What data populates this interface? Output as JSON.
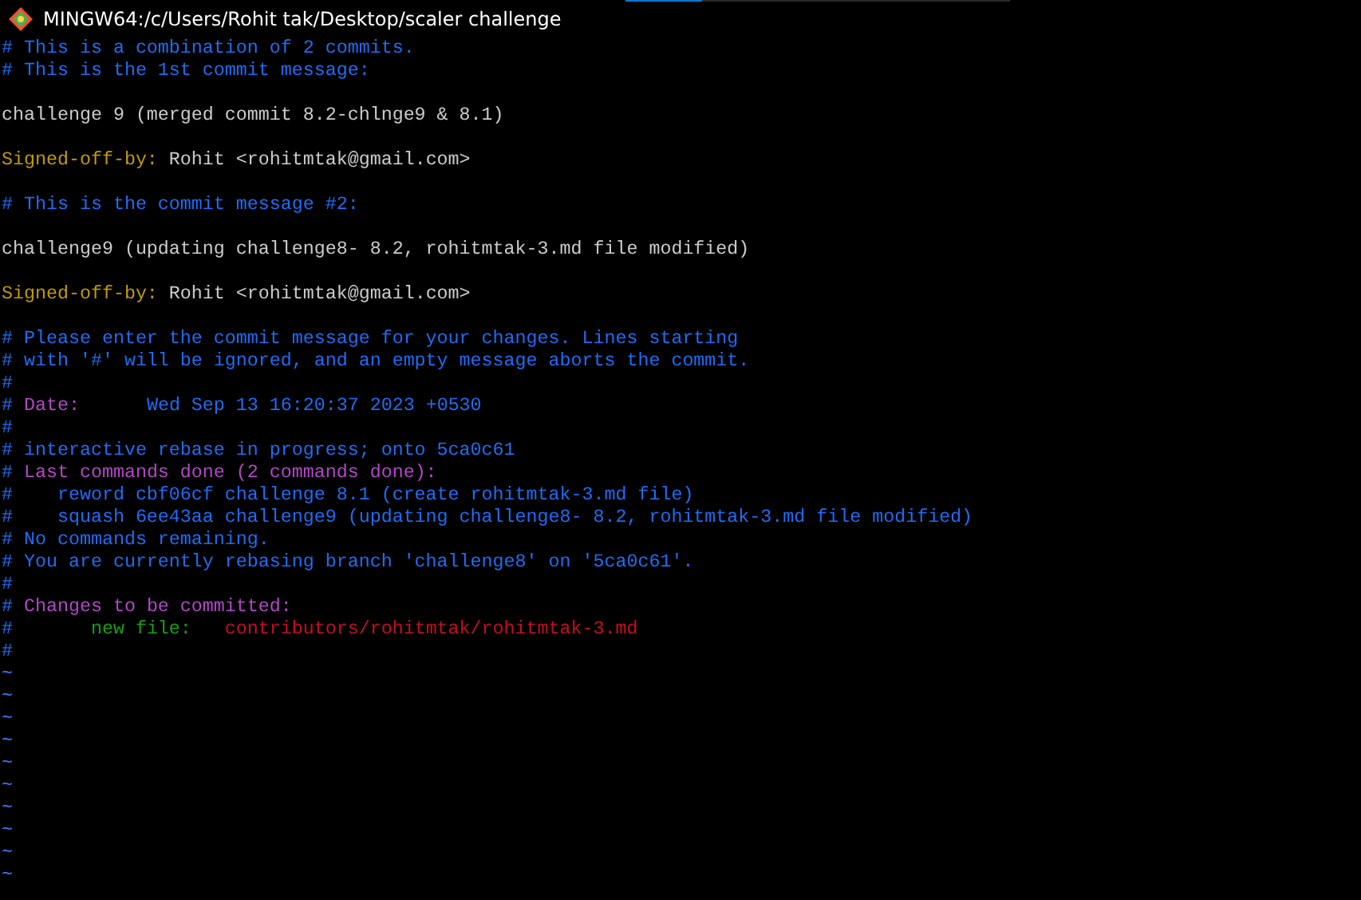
{
  "window": {
    "title": "MINGW64:/c/Users/Rohit tak/Desktop/scaler challenge"
  },
  "progress": {
    "level": 0.2
  },
  "lines": [
    {
      "kind": "text",
      "segments": [
        {
          "kind": "comment",
          "text": "# This is a combination of 2 commits."
        }
      ]
    },
    {
      "kind": "text",
      "segments": [
        {
          "kind": "comment",
          "text": "# This is the 1st commit message:"
        }
      ]
    },
    {
      "kind": "blank"
    },
    {
      "kind": "text",
      "segments": [
        {
          "kind": "plain",
          "text": "challenge 9 (merged commit 8.2-chlnge9 & 8.1)"
        }
      ]
    },
    {
      "kind": "blank"
    },
    {
      "kind": "text",
      "segments": [
        {
          "kind": "label",
          "text": "Signed-off-by:"
        },
        {
          "kind": "plain",
          "text": " Rohit <rohitmtak@gmail.com>"
        }
      ]
    },
    {
      "kind": "blank"
    },
    {
      "kind": "text",
      "segments": [
        {
          "kind": "comment",
          "text": "# This is the commit message #2:"
        }
      ]
    },
    {
      "kind": "blank"
    },
    {
      "kind": "text",
      "segments": [
        {
          "kind": "plain",
          "text": "challenge9 (updating challenge8- 8.2, rohitmtak-3.md file modified)"
        }
      ]
    },
    {
      "kind": "blank"
    },
    {
      "kind": "text",
      "segments": [
        {
          "kind": "label",
          "text": "Signed-off-by:"
        },
        {
          "kind": "plain",
          "text": " Rohit <rohitmtak@gmail.com>"
        }
      ]
    },
    {
      "kind": "blank"
    },
    {
      "kind": "text",
      "segments": [
        {
          "kind": "comment",
          "text": "# Please enter the commit message for your changes. Lines starting"
        }
      ]
    },
    {
      "kind": "text",
      "segments": [
        {
          "kind": "comment",
          "text": "# with '#' will be ignored, and an empty message aborts the commit."
        }
      ]
    },
    {
      "kind": "text",
      "segments": [
        {
          "kind": "comment",
          "text": "#"
        }
      ]
    },
    {
      "kind": "text",
      "segments": [
        {
          "kind": "comment",
          "text": "#"
        },
        {
          "kind": "heading",
          "text": " Date:"
        },
        {
          "kind": "comment",
          "text": "      Wed Sep 13 16:20:37 2023 +0530"
        }
      ]
    },
    {
      "kind": "text",
      "segments": [
        {
          "kind": "comment",
          "text": "#"
        }
      ]
    },
    {
      "kind": "text",
      "segments": [
        {
          "kind": "comment",
          "text": "# interactive rebase in progress; onto 5ca0c61"
        }
      ]
    },
    {
      "kind": "text",
      "segments": [
        {
          "kind": "comment",
          "text": "#"
        },
        {
          "kind": "heading",
          "text": " Last commands done (2 commands done):"
        }
      ]
    },
    {
      "kind": "text",
      "segments": [
        {
          "kind": "comment",
          "text": "#    reword cbf06cf challenge 8.1 (create rohitmtak-3.md file)"
        }
      ]
    },
    {
      "kind": "text",
      "segments": [
        {
          "kind": "comment",
          "text": "#    squash 6ee43aa challenge9 (updating challenge8- 8.2, rohitmtak-3.md file modified)"
        }
      ]
    },
    {
      "kind": "text",
      "segments": [
        {
          "kind": "comment",
          "text": "# No commands remaining."
        }
      ]
    },
    {
      "kind": "text",
      "segments": [
        {
          "kind": "comment",
          "text": "# You are currently rebasing branch 'challenge8' on '5ca0c61'."
        }
      ]
    },
    {
      "kind": "text",
      "segments": [
        {
          "kind": "comment",
          "text": "#"
        }
      ]
    },
    {
      "kind": "text",
      "segments": [
        {
          "kind": "comment",
          "text": "#"
        },
        {
          "kind": "heading",
          "text": " Changes to be committed:"
        }
      ]
    },
    {
      "kind": "text",
      "segments": [
        {
          "kind": "comment",
          "text": "#"
        },
        {
          "kind": "staged",
          "text": "       new file:"
        },
        {
          "kind": "path",
          "text": "   contributors/rohitmtak/rohitmtak-3.md"
        }
      ]
    },
    {
      "kind": "text",
      "segments": [
        {
          "kind": "comment",
          "text": "#"
        }
      ]
    },
    {
      "kind": "tilde",
      "text": "~"
    },
    {
      "kind": "tilde",
      "text": "~"
    },
    {
      "kind": "tilde",
      "text": "~"
    },
    {
      "kind": "tilde",
      "text": "~"
    },
    {
      "kind": "tilde",
      "text": "~"
    },
    {
      "kind": "tilde",
      "text": "~"
    },
    {
      "kind": "tilde",
      "text": "~"
    },
    {
      "kind": "tilde",
      "text": "~"
    },
    {
      "kind": "tilde",
      "text": "~"
    },
    {
      "kind": "tilde",
      "text": "~"
    }
  ]
}
